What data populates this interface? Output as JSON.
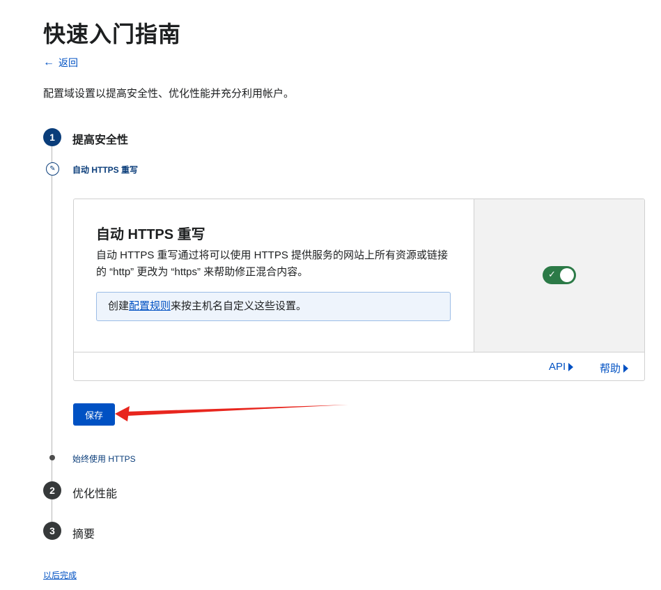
{
  "page": {
    "title": "快速入门指南",
    "back_label": "返回",
    "subtitle": "配置域设置以提高安全性、优化性能并充分利用帐户。"
  },
  "steps": [
    {
      "number": "1",
      "label": "提高安全性",
      "state": "active"
    },
    {
      "number": "2",
      "label": "优化性能",
      "state": "pending"
    },
    {
      "number": "3",
      "label": "摘要",
      "state": "pending"
    }
  ],
  "substeps": {
    "current": "自动 HTTPS 重写",
    "next": "始终使用 HTTPS"
  },
  "card": {
    "title": "自动 HTTPS 重写",
    "description": "自动 HTTPS 重写通过将可以使用 HTTPS 提供服务的网站上所有资源或链接的 “http” 更改为 “https” 来帮助修正混合内容。",
    "info_prefix": "创建",
    "info_link": "配置规则",
    "info_suffix": "来按主机名自定义这些设置。",
    "toggle_state": "on",
    "footer_api": "API",
    "footer_help": "帮助"
  },
  "actions": {
    "save_label": "保存",
    "finish_later": "以后完成"
  },
  "colors": {
    "primary": "#0051c3",
    "active_step": "#0a3d7a",
    "toggle_on": "#2c7a47",
    "annotation_arrow": "#e8261e"
  }
}
